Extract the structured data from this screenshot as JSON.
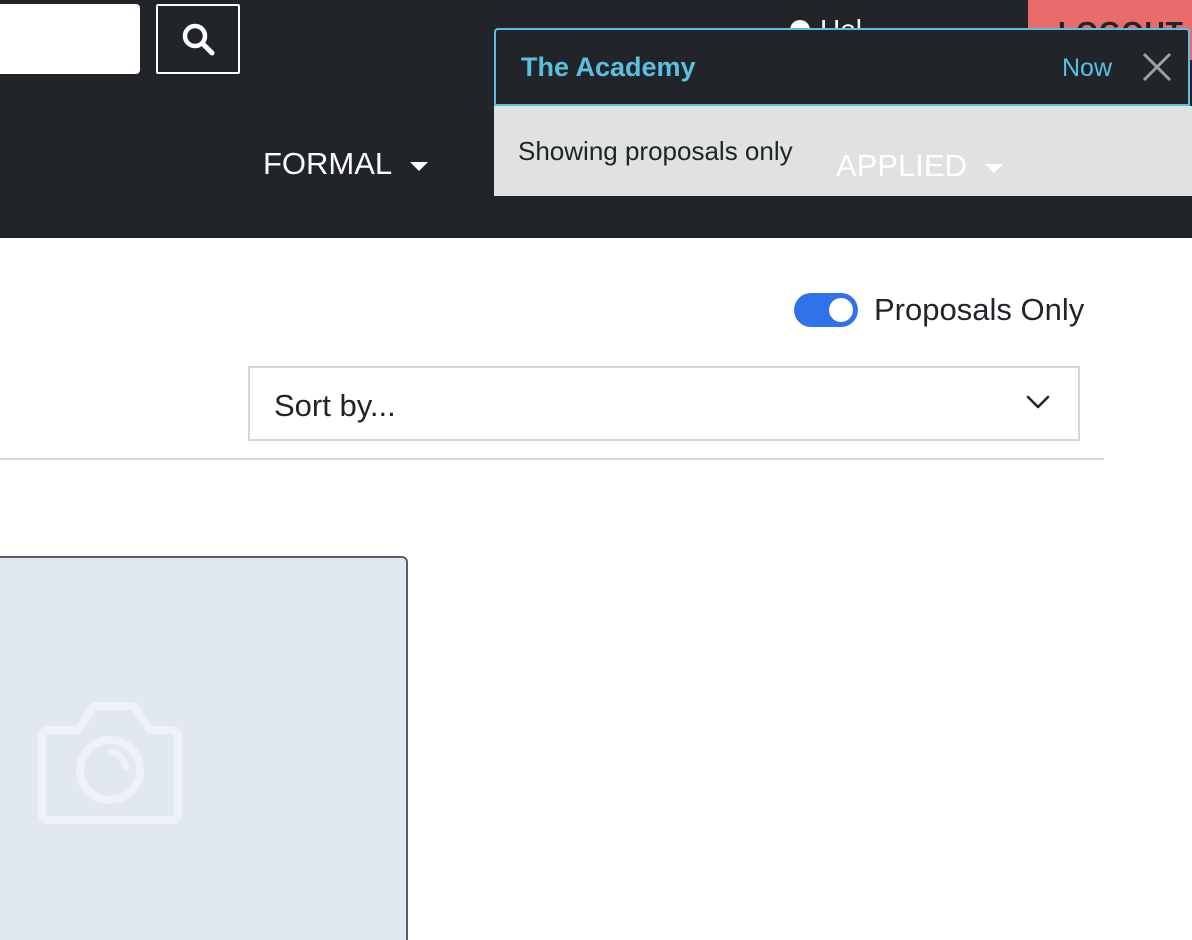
{
  "navbar": {
    "search": {
      "placeholder": "",
      "icon": "search-icon"
    },
    "user_link": {
      "label": "Hel",
      "icon": "user-icon"
    },
    "logout": {
      "label": "LOGOUT",
      "color": "#ea6b6b"
    },
    "menu": [
      {
        "label": "FORMAL"
      },
      {
        "label": "APPLIED"
      }
    ],
    "background": "#212529"
  },
  "toast": {
    "title": "The Academy",
    "time": "Now",
    "message": "Showing proposals only",
    "accent": "#5bc0de",
    "close_icon": "close-icon"
  },
  "filters": {
    "proposals_only": {
      "label": "Proposals Only",
      "checked": true,
      "color": "#2f72ea"
    },
    "sort": {
      "value": "Sort by...",
      "icon": "chevron-down-icon"
    }
  },
  "card": {
    "image_placeholder_icon": "camera-icon",
    "background": "#e2e8ef"
  }
}
